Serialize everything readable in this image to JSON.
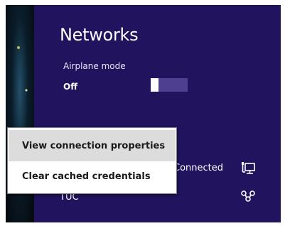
{
  "panel": {
    "title": "Networks",
    "airplane_mode": {
      "label": "Airplane mode",
      "value": "Off"
    },
    "networks": [
      {
        "name": "",
        "status": "Connected",
        "icon": "wired-network-icon"
      },
      {
        "name": "TUC",
        "status": "",
        "icon": "wireless-network-icon"
      }
    ]
  },
  "context_menu": {
    "items": [
      {
        "label": "View connection properties"
      },
      {
        "label": "Clear cached credentials"
      }
    ]
  },
  "colors": {
    "panel_bg": "#22135f",
    "toggle_track": "#4f3f91",
    "menu_highlight": "#dcdcdc"
  }
}
